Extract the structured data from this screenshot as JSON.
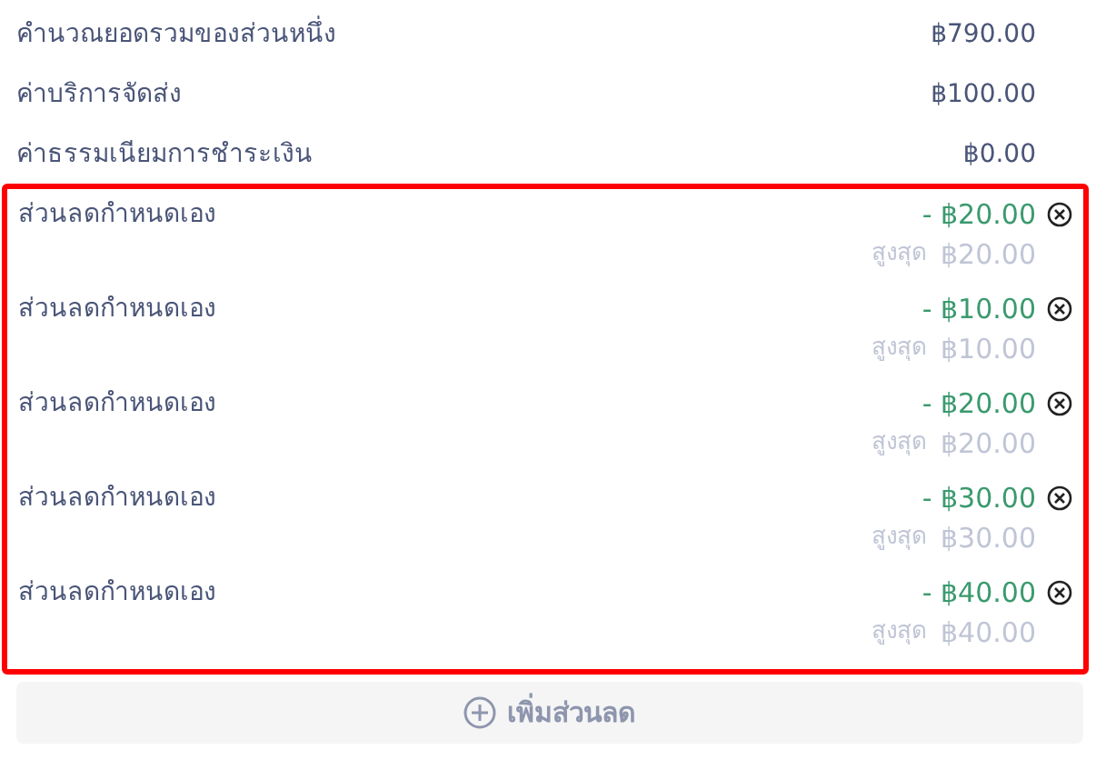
{
  "summary": [
    {
      "label": "คำนวณยอดรวมของส่วนหนึ่ง",
      "amount": "฿790.00"
    },
    {
      "label": "ค่าบริการจัดส่ง",
      "amount": "฿100.00"
    },
    {
      "label": "ค่าธรรมเนียมการชำระเงิน",
      "amount": "฿0.00"
    }
  ],
  "discounts": [
    {
      "label": "ส่วนลดกำหนดเอง",
      "amount": "- ฿20.00",
      "max_label": "สูงสุด",
      "max": "฿20.00"
    },
    {
      "label": "ส่วนลดกำหนดเอง",
      "amount": "- ฿10.00",
      "max_label": "สูงสุด",
      "max": "฿10.00"
    },
    {
      "label": "ส่วนลดกำหนดเอง",
      "amount": "- ฿20.00",
      "max_label": "สูงสุด",
      "max": "฿20.00"
    },
    {
      "label": "ส่วนลดกำหนดเอง",
      "amount": "- ฿30.00",
      "max_label": "สูงสุด",
      "max": "฿30.00"
    },
    {
      "label": "ส่วนลดกำหนดเอง",
      "amount": "- ฿40.00",
      "max_label": "สูงสุด",
      "max": "฿40.00"
    }
  ],
  "add_button": {
    "label": "เพิ่มส่วนลด",
    "disabled": true
  }
}
